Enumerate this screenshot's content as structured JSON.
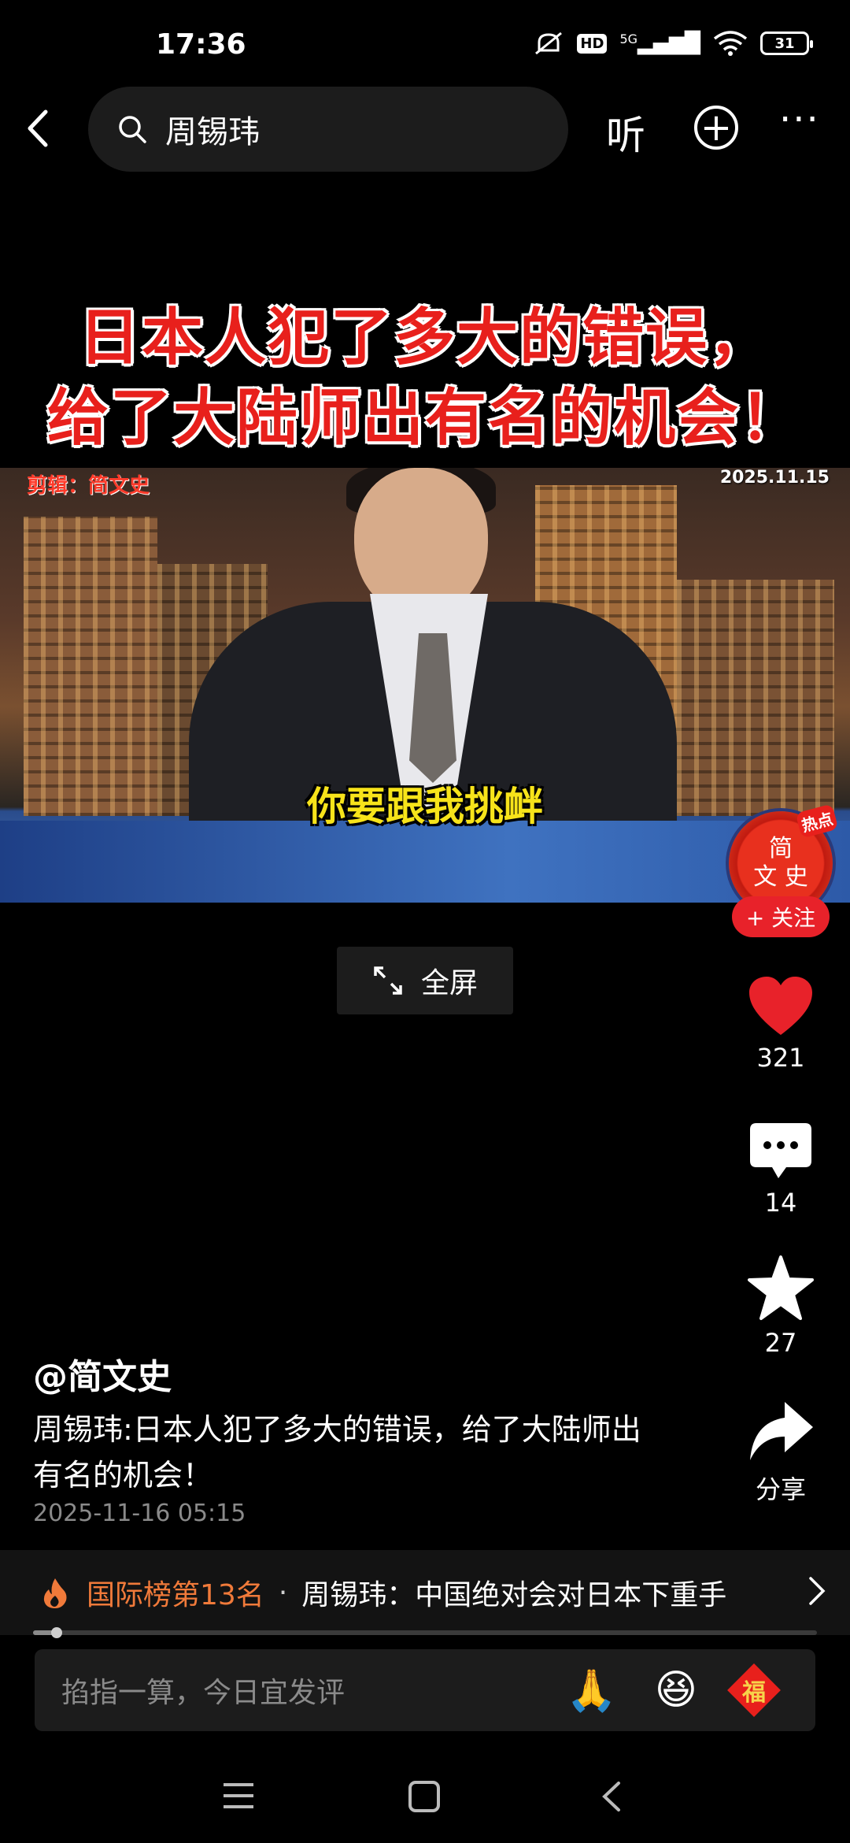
{
  "status_bar": {
    "time": "17:36",
    "network": "5G",
    "hd": "HD",
    "battery": "31"
  },
  "search": {
    "query": "周锡玮"
  },
  "nav": {
    "listen_label": "听",
    "plus_label": "+",
    "more_label": "···"
  },
  "video": {
    "headline_line1": "日本人犯了多大的错误，",
    "headline_line2": "给了大陆师出有名的机会！",
    "editor_label": "剪辑：简文史",
    "date_label": "2025.11.15",
    "caption": "你要跟我挑衅"
  },
  "creator": {
    "avatar_text_1": "简",
    "avatar_text_2": "文 史",
    "avatar_badge": "热点",
    "follow_label": "+ 关注"
  },
  "fullscreen": {
    "label": "全屏"
  },
  "actions": {
    "likes": "321",
    "comments": "14",
    "favorites": "27",
    "share_label": "分享"
  },
  "post": {
    "author": "@简文史",
    "description": "周锡玮:日本人犯了多大的错误，给了大陆师出有名的机会！",
    "date": "2025-11-16 05:15"
  },
  "ranking": {
    "rank_label": "国际榜第13名",
    "separator": "·",
    "topic": "周锡玮：中国绝对会对日本下重手"
  },
  "progress": {
    "fraction": 0.03
  },
  "comment": {
    "placeholder": "掐指一算，今日宜发评",
    "emoji_1": "🙏",
    "emoji_2": "😆",
    "fu_label": "福"
  },
  "colors": {
    "accent_red": "#e8222a",
    "rank_orange": "#f07a3a",
    "caption_yellow": "#f7e31a"
  }
}
